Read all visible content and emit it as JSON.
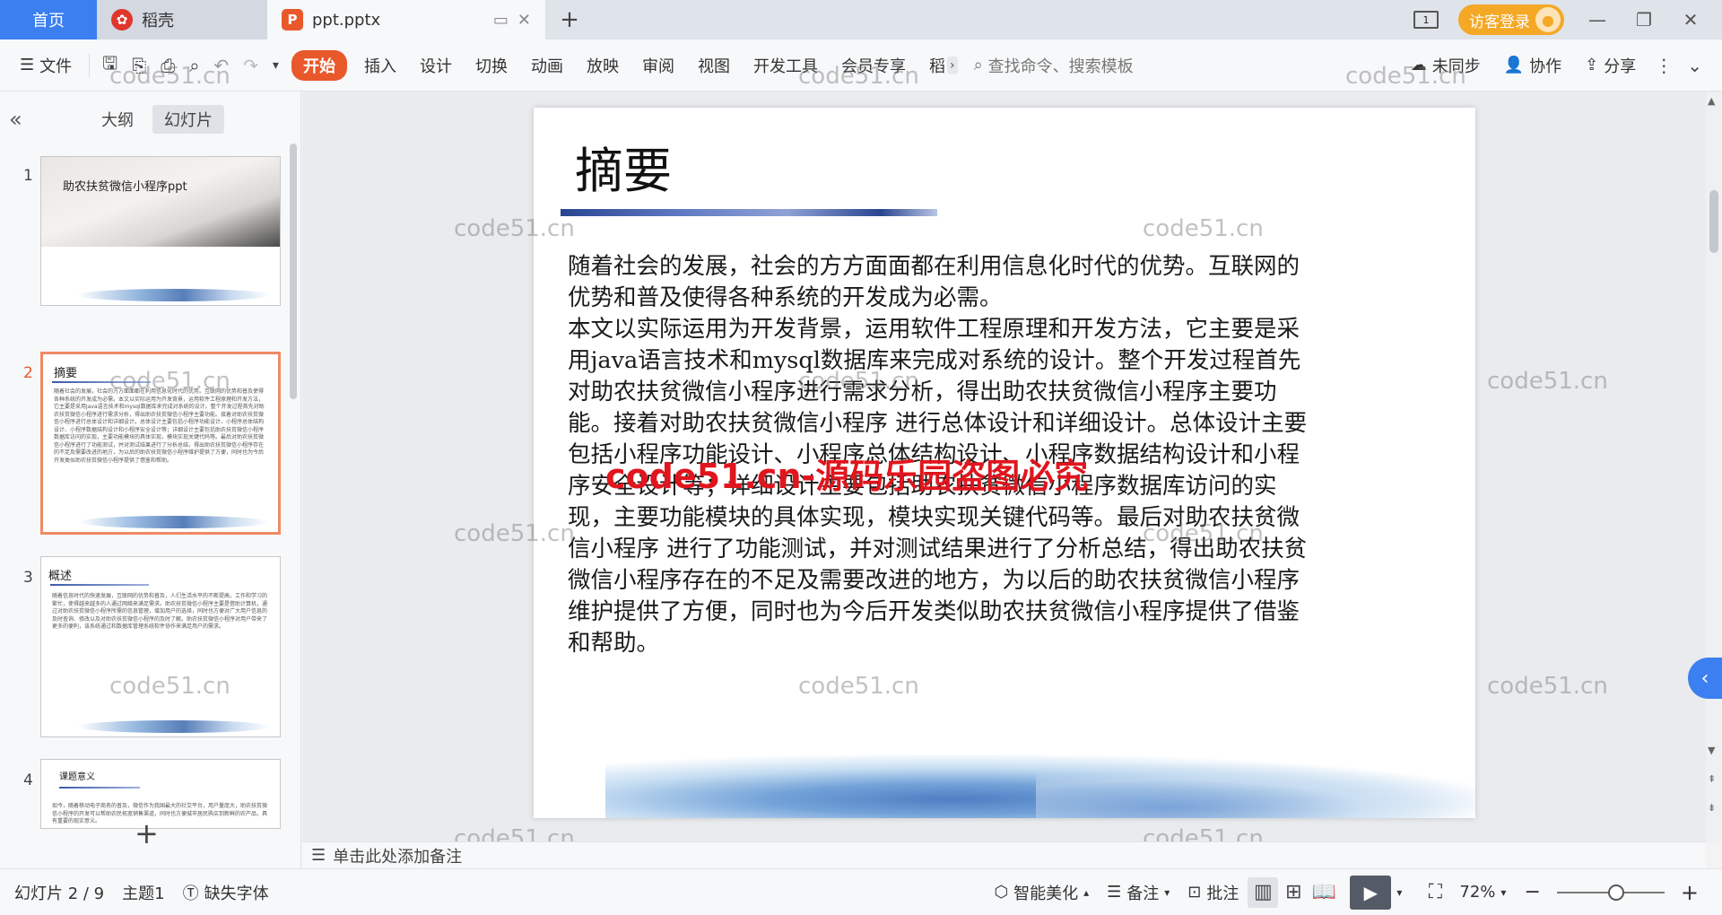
{
  "titlebar": {
    "home_tab": "首页",
    "tabs": [
      {
        "label": "稻壳",
        "icon": "docer-icon"
      },
      {
        "label": "ppt.pptx",
        "icon": "presentation-file-icon"
      }
    ],
    "new_tab_symbol": "+",
    "layout_badge": "1",
    "login_label": "访客登录",
    "window_controls": [
      "—",
      "❐",
      "✕"
    ]
  },
  "toolbar": {
    "file_label": "文件",
    "tabs": [
      "开始",
      "插入",
      "设计",
      "切换",
      "动画",
      "放映",
      "审阅",
      "视图",
      "开发工具",
      "会员专享",
      "稻"
    ],
    "active_tab": "开始",
    "search_placeholder": "查找命令、搜索模板",
    "sync_label": "未同步",
    "collab_label": "协作",
    "share_label": "分享"
  },
  "left_panel": {
    "tabs": [
      "大纲",
      "幻灯片"
    ],
    "active_tab": "幻灯片",
    "thumbnails": [
      {
        "number": "1",
        "title": "助农扶贫微信小程序ppt",
        "selected": false
      },
      {
        "number": "2",
        "title": "摘要",
        "selected": true,
        "text": "随着社会的发展，社会的方方面面都在利用信息化时代的优势。互联网的优势和普及使得各种系统的开发成为必需。本文以实际运用为开发背景，运用软件工程原理和开发方法，它主要是采用java语言技术和mysql数据库来完成对系统的设计。整个开发过程首先对助农扶贫微信小程序进行需求分析，得出助农扶贫微信小程序主要功能。接着对助农扶贫微信小程序进行总体设计和详细设计。总体设计主要包括小程序功能设计、小程序总体结构设计、小程序数据结构设计和小程序安全设计等；详细设计主要包括助农扶贫微信小程序数据库访问的实现，主要功能模块的具体实现，模块实现关键代码等。最后对助农扶贫微信小程序进行了功能测试，并对测试结果进行了分析总结，得出助农扶贫微信小程序存在的不足及需要改进的地方，为以后的助农扶贫微信小程序维护提供了方便，同时也为今后开发类似助农扶贫微信小程序提供了借鉴和帮助。"
      },
      {
        "number": "3",
        "title": "概述",
        "selected": false,
        "text": "随着信息时代的快速发展，互联网的优势和普及，人们生活水平的不断提高，工作和学习的繁忙，使得越来越多的人通过网络来满足需求。助农扶贫微信小程序主要是借助计算机，通过对助农扶贫微信小程序所需的信息管理，增加用户的选择，同时也方便对广大用户信息的及时查询、修改以及对助农扶贫微信小程序的及时了解。助农扶贫微信小程序对用户带来了更多的便利，该系统通过和数据库管理系统软件协作来满足用户的需求。"
      },
      {
        "number": "4",
        "title": "课题意义",
        "selected": false,
        "text": "如今，随着移动电子商务的普及，微信作为我国最大的社交平台，用户量庞大，助农扶贫微信小程序的开发可以帮助农民拓宽销售渠道，同时也方便城市居民购买到新鲜的农产品，具有重要的现实意义。"
      }
    ],
    "add_symbol": "+"
  },
  "slide": {
    "title": "摘要",
    "paragraphs": [
      "随着社会的发展，社会的方方面面都在利用信息化时代的优势。互联网的优势和普及使得各种系统的开发成为必需。",
      "本文以实际运用为开发背景，运用软件工程原理和开发方法，它主要是采用java语言技术和mysql数据库来完成对系统的设计。整个开发过程首先对助农扶贫微信小程序进行需求分析，得出助农扶贫微信小程序主要功能。接着对助农扶贫微信小程序 进行总体设计和详细设计。总体设计主要包括小程序功能设计、小程序总体结构设计、小程序数据结构设计和小程序安全设计等；详细设计主要包括助农扶贫微信小程序数据库访问的实现，主要功能模块的具体实现，模块实现关键代码等。最后对助农扶贫微信小程序 进行了功能测试，并对测试结果进行了分析总结，得出助农扶贫微信小程序存在的不足及需要改进的地方，为以后的助农扶贫微信小程序维护提供了方便，同时也为今后开发类似助农扶贫微信小程序提供了借鉴和帮助。"
    ]
  },
  "watermarks": {
    "site": "code51.cn",
    "red_notice": "code51.cn-源码乐园盗图必究"
  },
  "notes": {
    "placeholder": "单击此处添加备注"
  },
  "statusbar": {
    "slide_counter": "幻灯片 2 / 9",
    "theme": "主题1",
    "missing_font": "缺失字体",
    "smart_beautify": "智能美化",
    "notes_label": "备注",
    "comments_label": "批注",
    "zoom": "72%",
    "zoom_fraction": 0.55
  },
  "colors": {
    "accent": "#e8582b",
    "home_tab": "#3b7ff0",
    "login": "#f4a826",
    "red_watermark": "#e0151d"
  }
}
